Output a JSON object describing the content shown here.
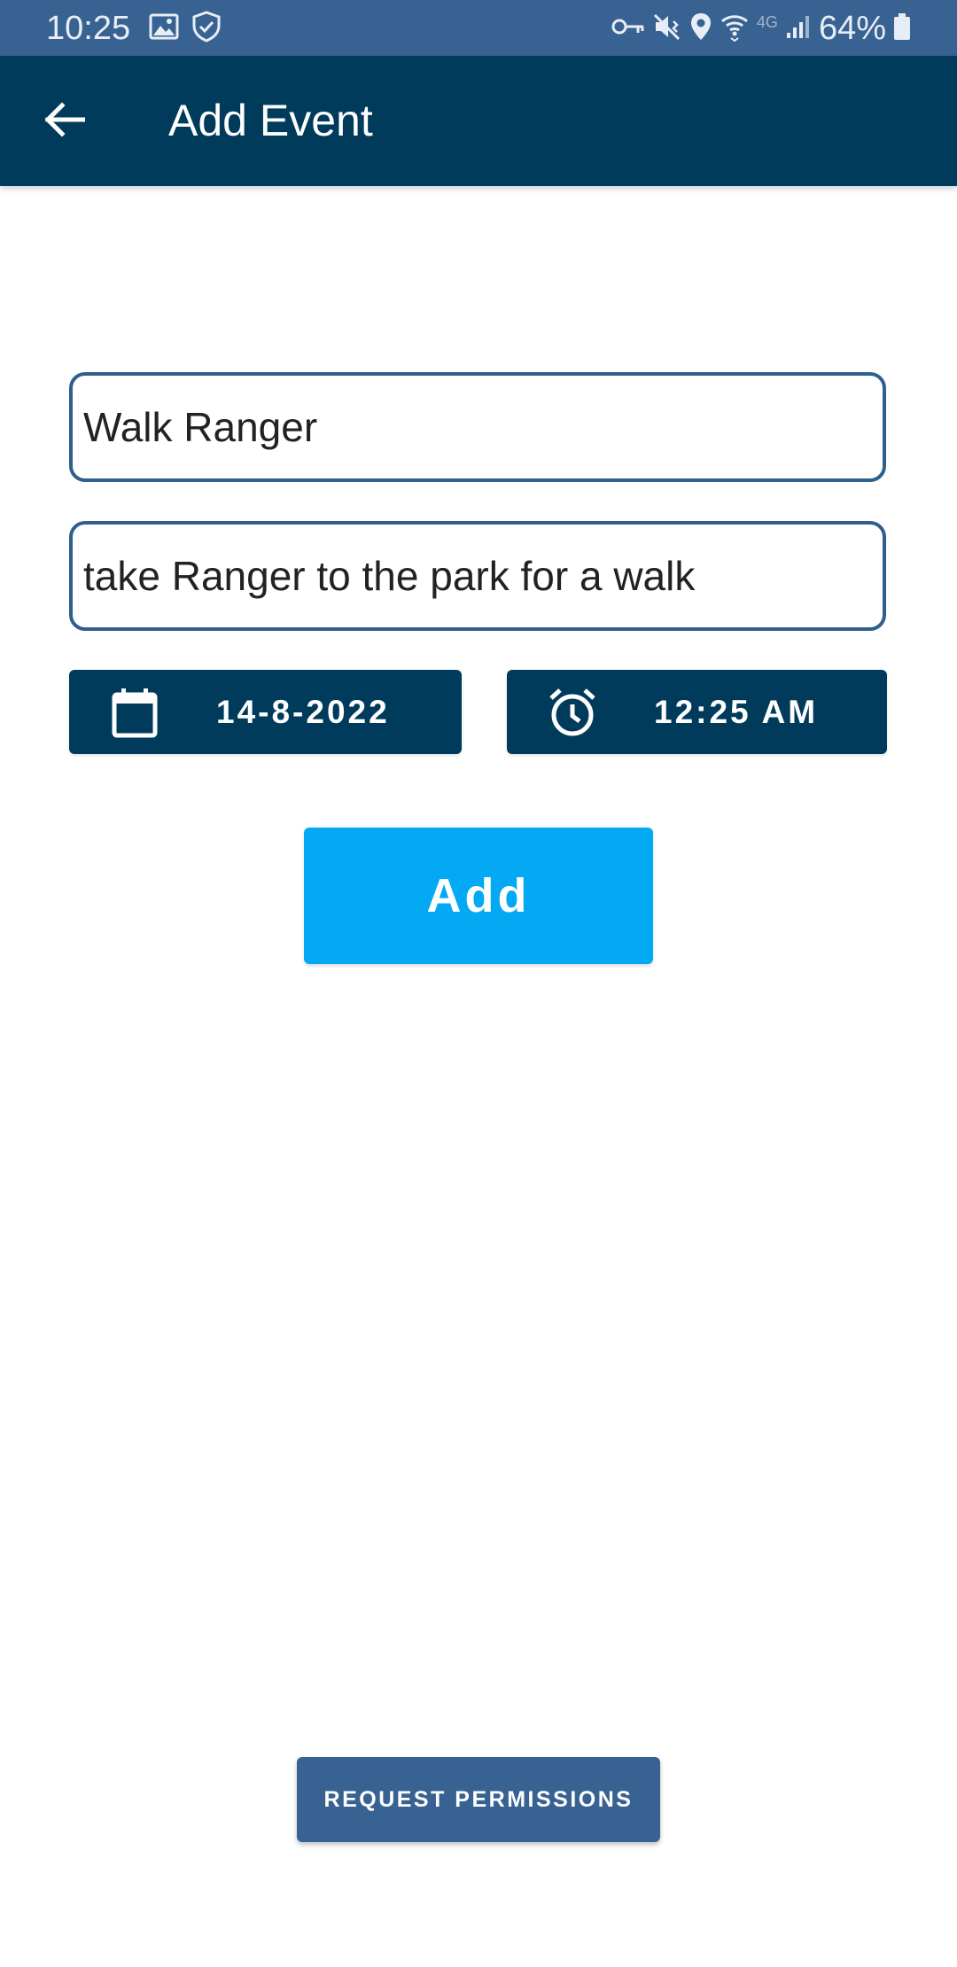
{
  "status_bar": {
    "time": "10:25",
    "left_icons": [
      "image-icon",
      "shield-check-icon"
    ],
    "right_icons": [
      "key-icon",
      "mute-vibrate-icon",
      "location-icon",
      "wifi-icon",
      "signal-icon",
      "battery-icon"
    ],
    "network_label": "4G",
    "battery": "64%"
  },
  "app_bar": {
    "title": "Add Event",
    "back_icon": "arrow-back-icon"
  },
  "form": {
    "title_value": "Walk Ranger",
    "description_value": "take Ranger to the park for a walk",
    "date_label": "14-8-2022",
    "date_icon": "calendar-icon",
    "time_label": "12:25 AM",
    "time_icon": "alarm-clock-icon",
    "add_label": "Add"
  },
  "footer": {
    "permissions_label": "REQUEST PERMISSIONS"
  },
  "colors": {
    "status_bar": "#386292",
    "app_bar": "#003b5c",
    "field_border": "#2f5f8d",
    "add_button": "#04a9f4",
    "permissions_button": "#386292"
  }
}
